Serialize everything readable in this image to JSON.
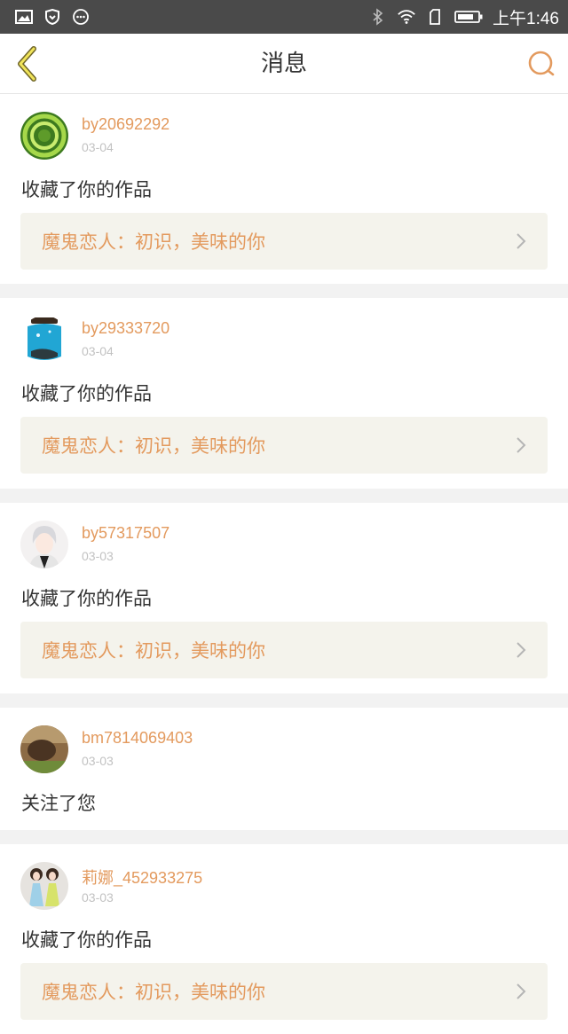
{
  "status_bar": {
    "time": "上午1:46",
    "left_icons": [
      "image-icon",
      "shield-icon",
      "more-dots-icon"
    ],
    "right_icons": [
      "bluetooth-icon",
      "wifi-icon",
      "sim-icon",
      "battery-icon"
    ]
  },
  "header": {
    "title": "消息",
    "back_icon": "back-chevron-icon",
    "search_icon": "search-icon",
    "accent_color": "#e39a5e"
  },
  "messages": [
    {
      "username": "by20692292",
      "date": "03-04",
      "action": "收藏了你的作品",
      "work_title": "魔鬼恋人：初识，美味的你",
      "avatar": "avatar-green-rings"
    },
    {
      "username": "by29333720",
      "date": "03-04",
      "action": "收藏了你的作品",
      "work_title": "魔鬼恋人：初识，美味的你",
      "avatar": "avatar-blue-jar"
    },
    {
      "username": "by57317507",
      "date": "03-03",
      "action": "收藏了你的作品",
      "work_title": "魔鬼恋人：初识，美味的你",
      "avatar": "avatar-anime-boy"
    },
    {
      "username": "bm7814069403",
      "date": "03-03",
      "action": "关注了您",
      "avatar": "avatar-brown-photo"
    },
    {
      "username": "莉娜_452933275",
      "date": "03-03",
      "action": "收藏了你的作品",
      "work_title": "魔鬼恋人：初识，美味的你",
      "avatar": "avatar-two-girls"
    }
  ]
}
